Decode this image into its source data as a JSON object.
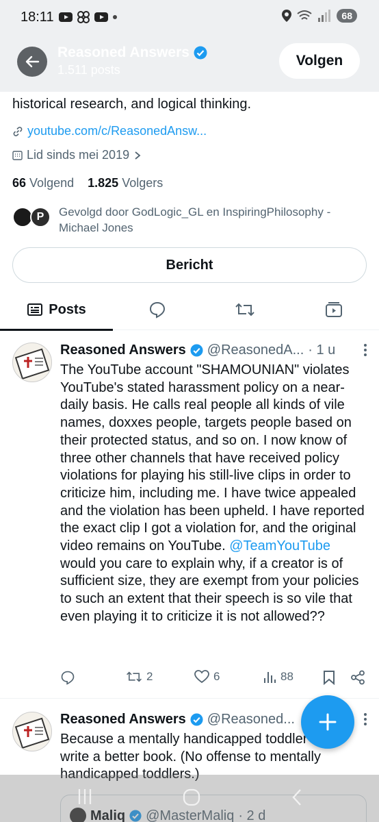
{
  "status_bar": {
    "time": "18:11",
    "battery": "68"
  },
  "header": {
    "name": "Reasoned Answers",
    "posts_count": "1.511 posts",
    "follow_label": "Volgen"
  },
  "profile": {
    "bio_tail": "historical research, and logical thinking.",
    "link": "youtube.com/c/ReasonedAnsw...",
    "joined": "Lid sinds mei 2019",
    "following_count": "66",
    "following_label": "Volgend",
    "followers_count": "1.825",
    "followers_label": "Volgers",
    "followed_by": "Gevolgd door GodLogic_GL en InspiringPhilosophy - Michael Jones",
    "message_label": "Bericht"
  },
  "tabs": {
    "posts_label": "Posts"
  },
  "tweets": [
    {
      "name": "Reasoned Answers",
      "handle": "@ReasonedA...",
      "time": "· 1 u",
      "text_before": "The YouTube account \"SHAMOUNIAN\" violates YouTube's stated harassment policy on a near-daily basis.  He calls real people all kinds of vile names, doxxes people, targets people based on their protected status, and so on.  I now know of three other channels that have received policy violations for playing his still-live clips in order to criticize him, including me.  I have twice appealed and the violation has been upheld.  I have reported the exact clip I got a violation for, and the original video remains on YouTube. ",
      "mention": "@TeamYouTube",
      "text_after": " would you care to explain why, if a creator is of sufficient size, they are exempt from your policies to such an extent that their speech is so vile that even playing it to criticize it is not allowed??",
      "retweets": "2",
      "likes": "6",
      "views": "88"
    },
    {
      "name": "Reasoned Answers",
      "handle": "@Reasoned...",
      "text": "Because a mentally handicapped toddler could write a better book. (No offense to mentally handicapped toddlers.)",
      "quote_name": "Maliq",
      "quote_handle": "@MasterMaliq",
      "quote_time": "· 2 d"
    }
  ],
  "colors": {
    "accent": "#1d9bf0",
    "header_bg": "#eef0f2",
    "muted": "#536471"
  }
}
